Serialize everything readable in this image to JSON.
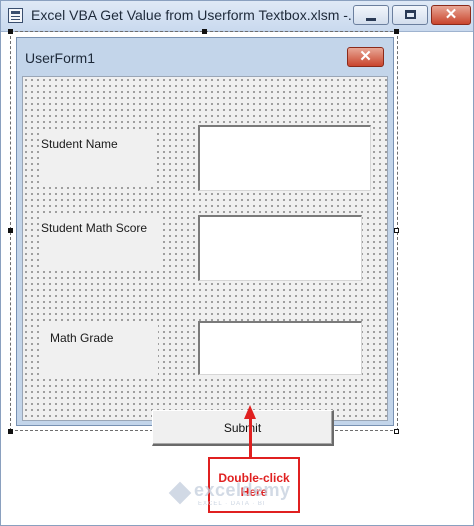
{
  "window": {
    "title": "Excel VBA Get Value from Userform Textbox.xlsm -...",
    "minimize_icon": "minimize-icon",
    "maximize_icon": "maximize-icon",
    "close_glyph": "✕"
  },
  "userform": {
    "title": "UserForm1",
    "close_glyph": "✕",
    "labels": {
      "student_name": "Student Name",
      "math_score": "Student Math Score",
      "math_grade": "Math Grade"
    },
    "textboxes": {
      "student_name": "",
      "math_score": "",
      "math_grade": ""
    },
    "submit_label": "Submit"
  },
  "annotation": {
    "line1": "Double-click",
    "line2": "Here",
    "color": "#e02020"
  },
  "watermark": {
    "name": "exceldemy",
    "tagline": "EXCEL · DATA · BI"
  },
  "colors": {
    "title_bar": "#c9d9ee",
    "form_background": "#f0f0f0",
    "close_button": "#c9452d"
  }
}
